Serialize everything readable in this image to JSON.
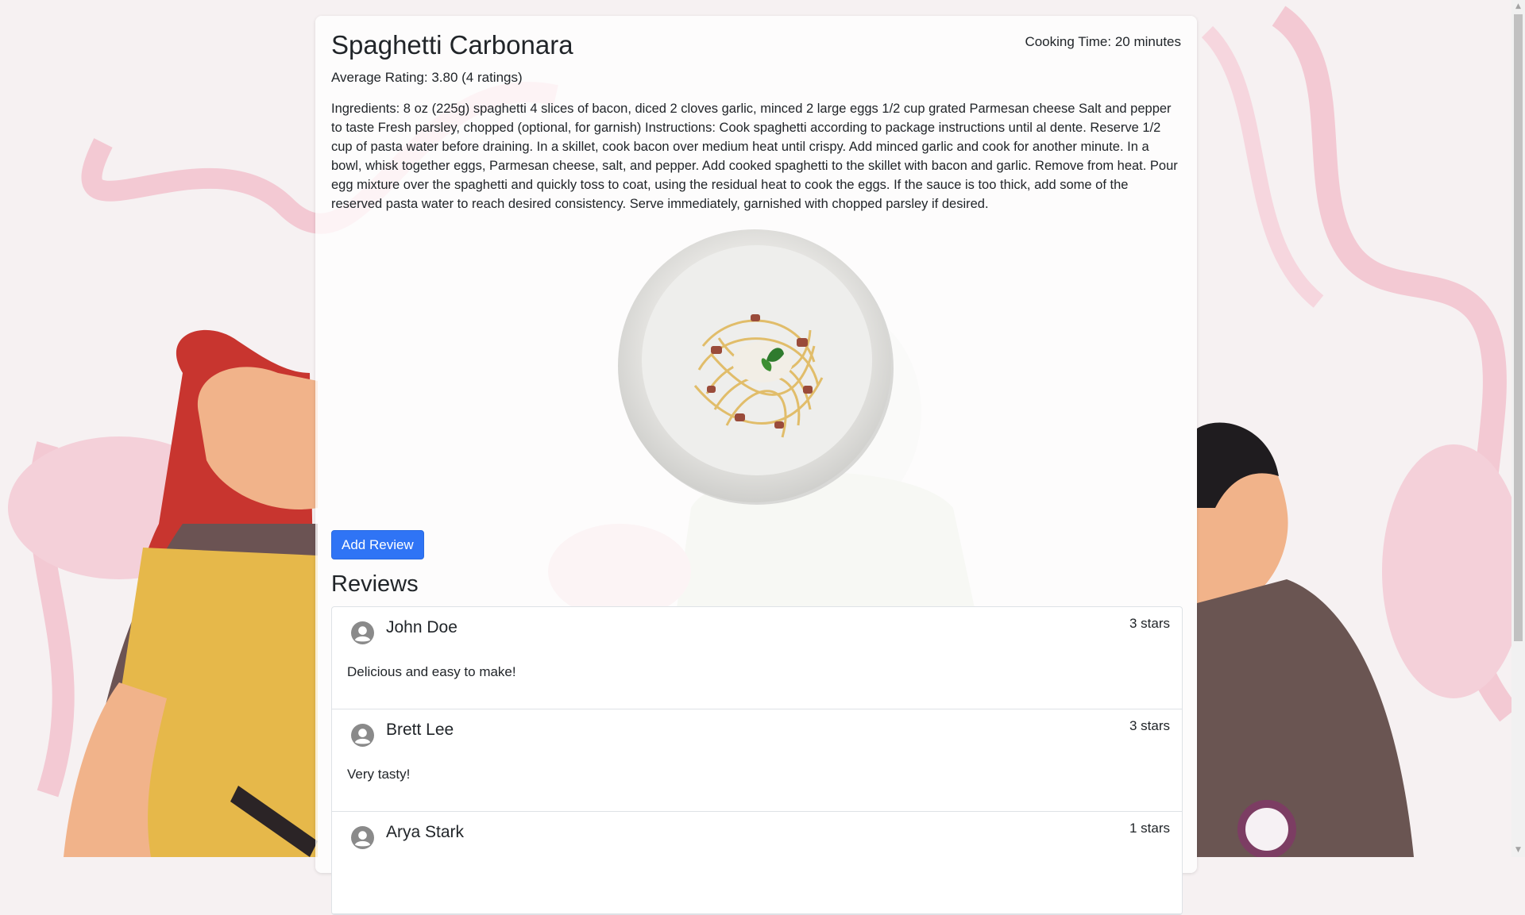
{
  "recipe": {
    "title": "Spaghetti Carbonara",
    "cooking_time": "Cooking Time: 20 minutes",
    "average_rating": "Average Rating: 3.80 (4 ratings)",
    "description": "Ingredients: 8 oz (225g) spaghetti 4 slices of bacon, diced 2 cloves garlic, minced 2 large eggs 1/2 cup grated Parmesan cheese Salt and pepper to taste Fresh parsley, chopped (optional, for garnish) Instructions: Cook spaghetti according to package instructions until al dente. Reserve 1/2 cup of pasta water before draining. In a skillet, cook bacon over medium heat until crispy. Add minced garlic and cook for another minute. In a bowl, whisk together eggs, Parmesan cheese, salt, and pepper. Add cooked spaghetti to the skillet with bacon and garlic. Remove from heat. Pour egg mixture over the spaghetti and quickly toss to coat, using the residual heat to cook the eggs. If the sauce is too thick, add some of the reserved pasta water to reach desired consistency. Serve immediately, garnished with chopped parsley if desired."
  },
  "actions": {
    "add_review_label": "Add Review"
  },
  "reviews": {
    "heading": "Reviews",
    "items": [
      {
        "author": "John Doe",
        "stars": "3 stars",
        "comment": "Delicious and easy to make!"
      },
      {
        "author": "Brett Lee",
        "stars": "3 stars",
        "comment": "Very tasty!"
      },
      {
        "author": "Arya Stark",
        "stars": "1 stars",
        "comment": ""
      }
    ]
  },
  "icons": {
    "avatar": "user-circle-icon",
    "dish_image": "spaghetti-plate-image",
    "scroll_up": "triangle-up-icon",
    "scroll_down": "triangle-down-icon"
  },
  "colors": {
    "primary_button": "#2f74f5",
    "background_tint": "#f6f1f2"
  }
}
